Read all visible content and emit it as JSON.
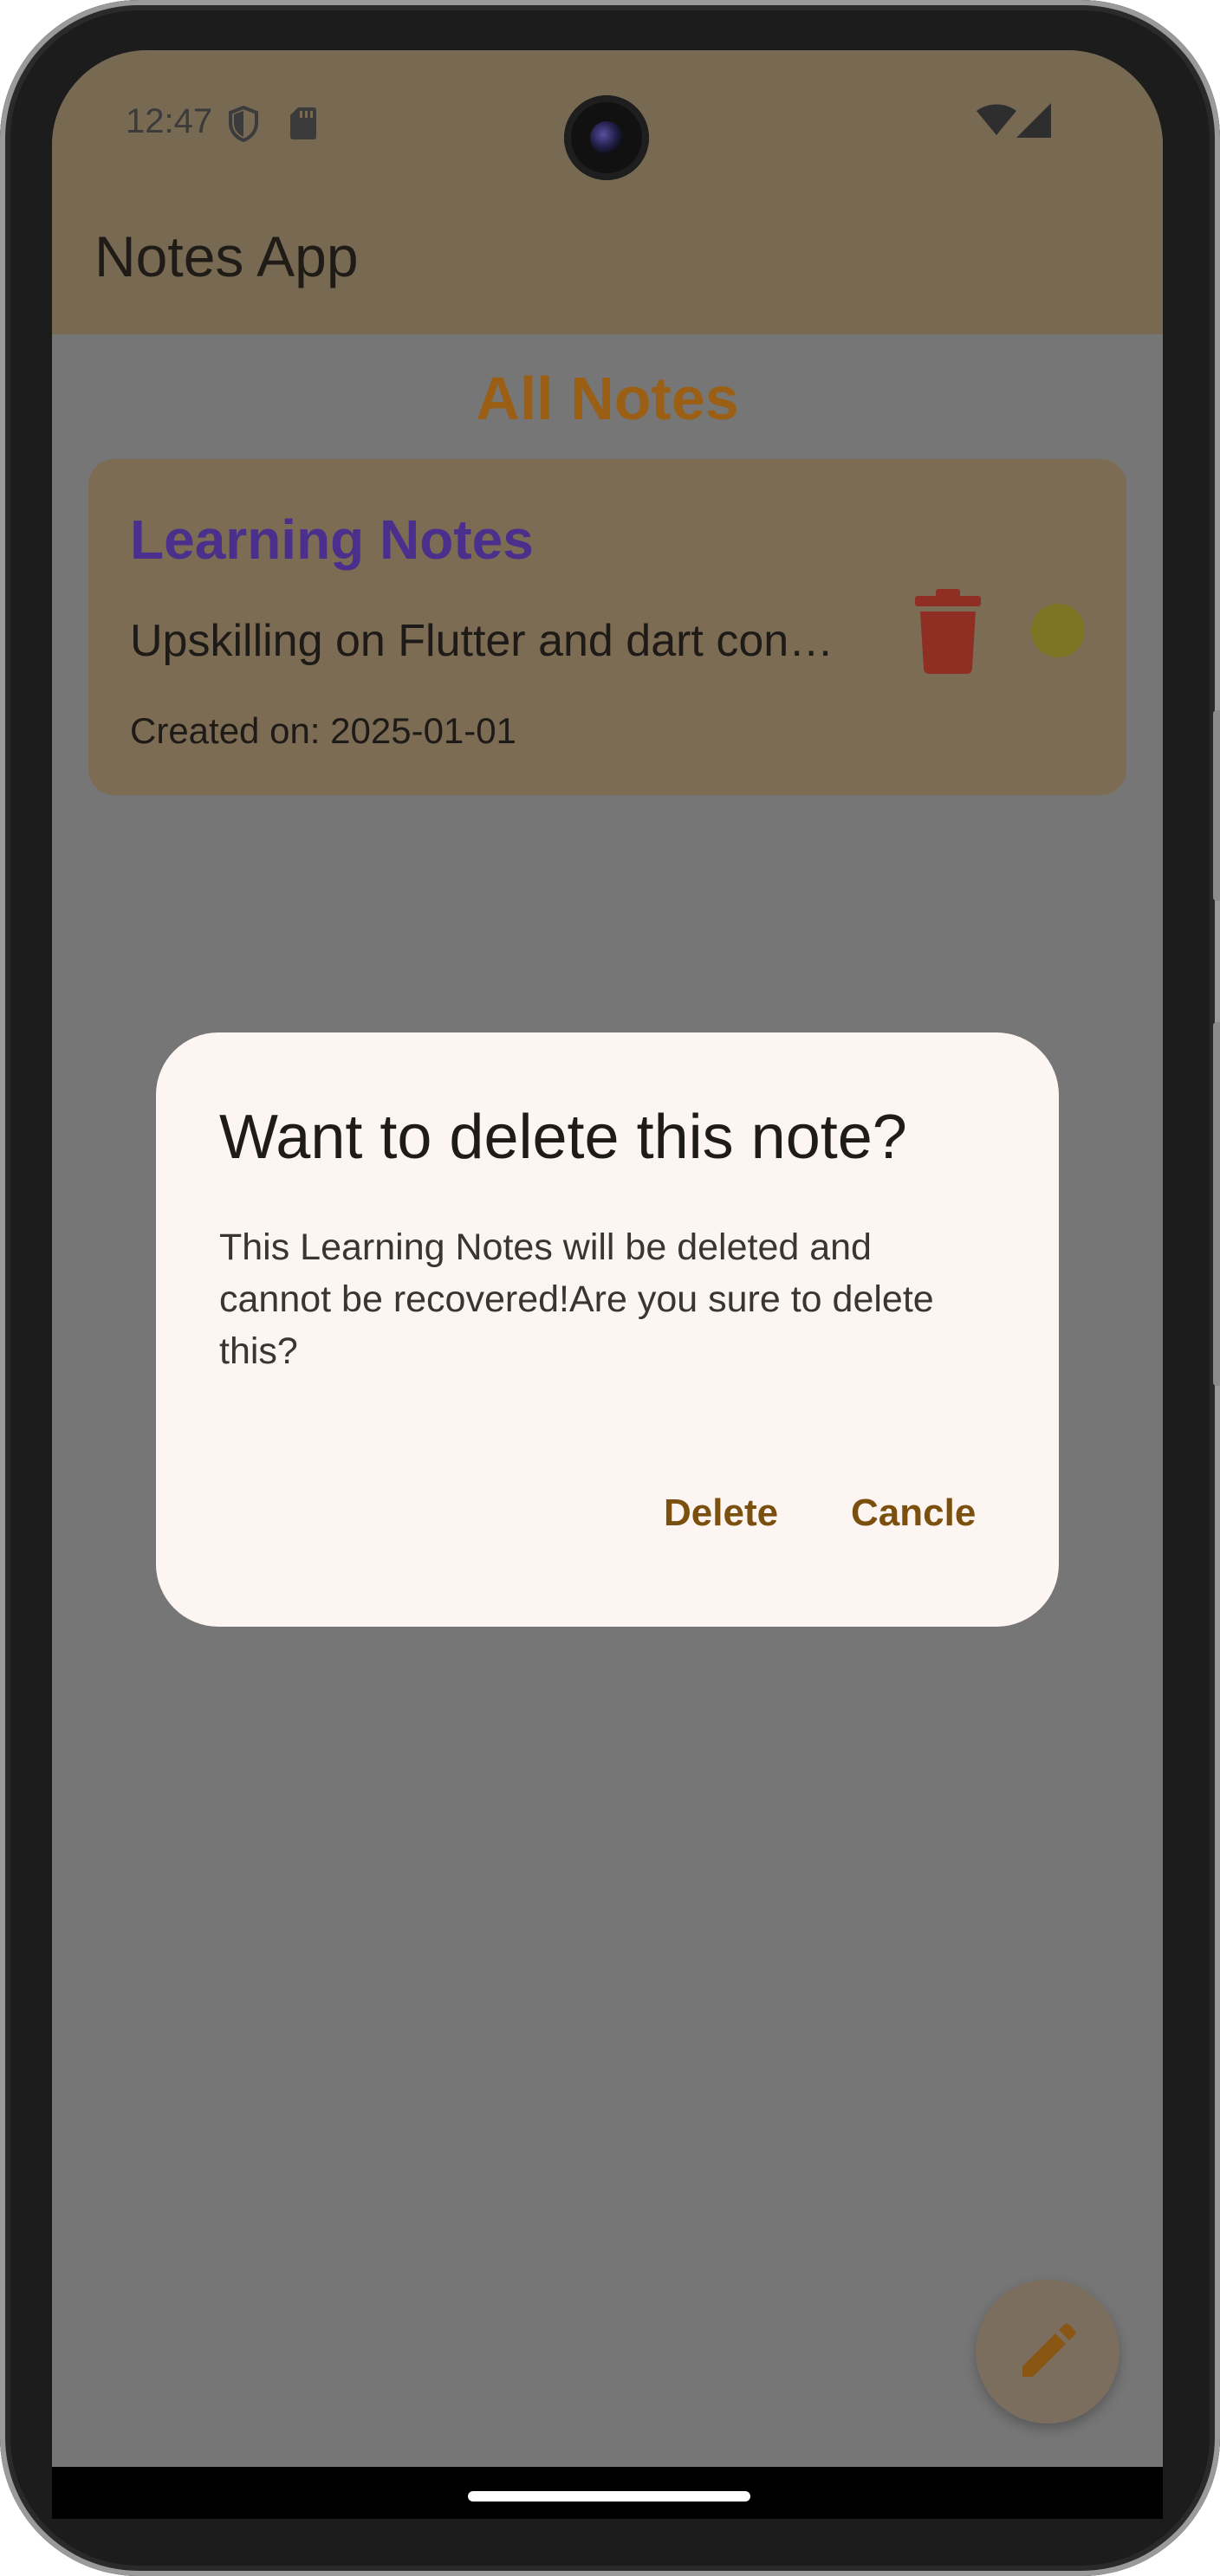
{
  "status_bar": {
    "time": "12:47",
    "icons": [
      "shield-icon",
      "sd-card-icon",
      "wifi-icon",
      "signal-icon"
    ]
  },
  "app_bar": {
    "title": "Notes App",
    "background": "#786a52"
  },
  "main": {
    "section_title": "All Notes",
    "notes": [
      {
        "title": "Learning Notes",
        "body": "Upskilling on Flutter and dart con…",
        "created": "Created on: 2025-01-01",
        "delete_icon": "trash-icon",
        "color_dot": "#7d7424"
      }
    ]
  },
  "dialog": {
    "title": "Want to delete this note?",
    "message": "This Learning Notes will be deleted and cannot be recovered!Are you sure to delete this?",
    "delete_label": "Delete",
    "cancel_label": "Cancle"
  },
  "fab": {
    "icon": "pencil-icon"
  },
  "colors": {
    "accent": "#9a5f14",
    "note_title": "#4a2f8c",
    "delete_red": "#8f2f24",
    "dialog_bg": "#fdf5f2",
    "scrim": "#767676"
  }
}
